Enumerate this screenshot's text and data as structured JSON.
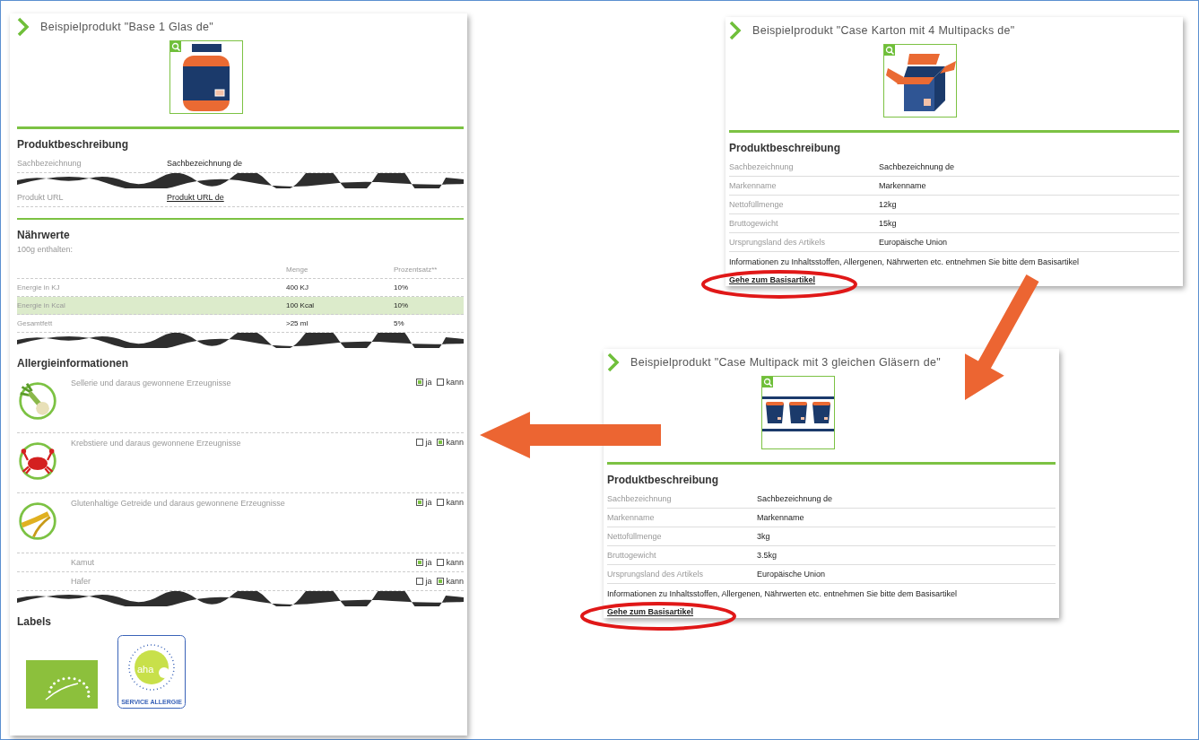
{
  "base_product": {
    "title": "Beispielprodukt \"Base 1 Glas de\"",
    "description": {
      "heading": "Produktbeschreibung",
      "rows": [
        {
          "kind": "text",
          "label": "Sachbezeichnung",
          "value": "Sachbezeichnung de"
        },
        {
          "kind": "tear"
        },
        {
          "kind": "link",
          "label": "Produkt URL",
          "value": "Produkt URL de"
        }
      ]
    },
    "nutrition": {
      "heading": "Nährwerte",
      "note": "100g enthalten:",
      "columns": [
        "Menge",
        "Prozentsatz**"
      ],
      "rows": [
        {
          "kind": "row",
          "label": "Energie in KJ",
          "amount": "400 KJ",
          "percent": "10%",
          "highlighted": false
        },
        {
          "kind": "row",
          "label": "Energie in Kcal",
          "amount": "100 Kcal",
          "percent": "10%",
          "highlighted": true
        },
        {
          "kind": "row",
          "label": "Gesamtfett",
          "amount": ">25 ml",
          "percent": "5%",
          "highlighted": false
        },
        {
          "kind": "tear"
        }
      ]
    },
    "allergens": {
      "heading": "Allergieinformationen",
      "items": [
        {
          "kind": "main",
          "label": "Sellerie und daraus gewonnene Erzeugnisse",
          "yes": {
            "label": "ja",
            "checked": true
          },
          "may": {
            "label": "kann",
            "checked": false
          }
        },
        {
          "kind": "main",
          "label": "Krebstiere und daraus gewonnene Erzeugnisse",
          "yes": {
            "label": "ja",
            "checked": false
          },
          "may": {
            "label": "kann",
            "checked": true
          }
        },
        {
          "kind": "main",
          "label": "Glutenhaltige Getreide und daraus gewonnene Erzeugnisse",
          "yes": {
            "label": "ja",
            "checked": true
          },
          "may": {
            "label": "kann",
            "checked": false
          }
        },
        {
          "kind": "sub",
          "label": "Kamut",
          "yes": {
            "label": "ja",
            "checked": true
          },
          "may": {
            "label": "kann",
            "checked": false
          }
        },
        {
          "kind": "sub",
          "label": "Hafer",
          "yes": {
            "label": "ja",
            "checked": false
          },
          "may": {
            "label": "kann",
            "checked": true
          }
        },
        {
          "kind": "tear"
        }
      ]
    },
    "labels": {
      "heading": "Labels",
      "items": [
        {
          "kind": "eu_organic"
        },
        {
          "kind": "aha",
          "text": "aha",
          "caption": "SERVICE ALLERGIE"
        }
      ]
    }
  },
  "cases": [
    {
      "title": "Beispielprodukt \"Case Karton mit 4 Multipacks de\"",
      "heading": "Produktbeschreibung",
      "rows": [
        {
          "label": "Sachbezeichnung",
          "value": "Sachbezeichnung de"
        },
        {
          "label": "Markenname",
          "value": "Markenname"
        },
        {
          "label": "Nettofüllmenge",
          "value": "12kg"
        },
        {
          "label": "Bruttogewicht",
          "value": "15kg"
        },
        {
          "label": "Ursprungsland des Artikels",
          "value": "Europäische Union"
        }
      ],
      "note": "Informationen zu Inhaltsstoffen, Allergenen, Nährwerten etc. entnehmen Sie bitte dem Basisartikel",
      "link": "Gehe zum Basisartikel"
    },
    {
      "title": "Beispielprodukt \"Case Multipack mit 3 gleichen Gläsern de\"",
      "heading": "Produktbeschreibung",
      "rows": [
        {
          "label": "Sachbezeichnung",
          "value": "Sachbezeichnung de"
        },
        {
          "label": "Markenname",
          "value": "Markenname"
        },
        {
          "label": "Nettofüllmenge",
          "value": "3kg"
        },
        {
          "label": "Bruttogewicht",
          "value": "3.5kg"
        },
        {
          "label": "Ursprungsland des Artikels",
          "value": "Europäische Union"
        }
      ],
      "note": "Informationen zu Inhaltsstoffen, Allergenen, Nährwerten etc. entnehmen Sie bitte dem Basisartikel",
      "link": "Gehe zum Basisartikel"
    }
  ]
}
